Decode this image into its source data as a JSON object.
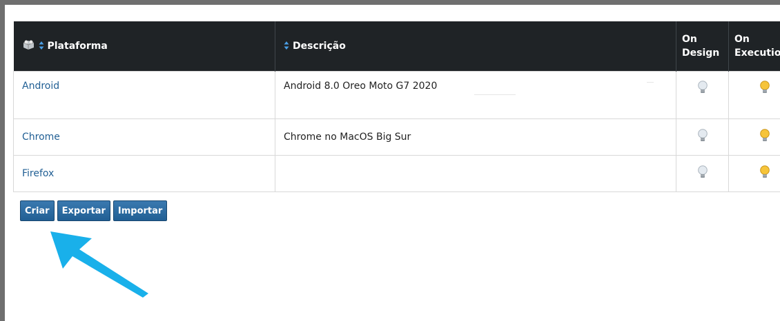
{
  "table": {
    "headers": {
      "platform": "Plataforma",
      "description": "Descrição",
      "on_design": "On Design",
      "on_execution": "On Executio"
    },
    "rows": [
      {
        "platform": "Android",
        "description": "Android 8.0 Oreo Moto G7 2020",
        "on_design_icon": "lightbulb-off-icon",
        "on_execution_icon": "lightbulb-on-icon"
      },
      {
        "platform": "Chrome",
        "description": "Chrome no MacOS Big Sur",
        "on_design_icon": "lightbulb-off-icon",
        "on_execution_icon": "lightbulb-on-icon"
      },
      {
        "platform": "Firefox",
        "description": "",
        "on_design_icon": "lightbulb-off-icon",
        "on_execution_icon": "lightbulb-on-icon"
      }
    ]
  },
  "buttons": {
    "create": "Criar",
    "export": "Exportar",
    "import": "Importar"
  },
  "colors": {
    "header_bg": "#1f2326",
    "link": "#215f94",
    "button": "#2d6a9f",
    "arrow": "#19b0ea",
    "bulb_on": "#f6c43a",
    "bulb_off": "#e4eaf0"
  }
}
